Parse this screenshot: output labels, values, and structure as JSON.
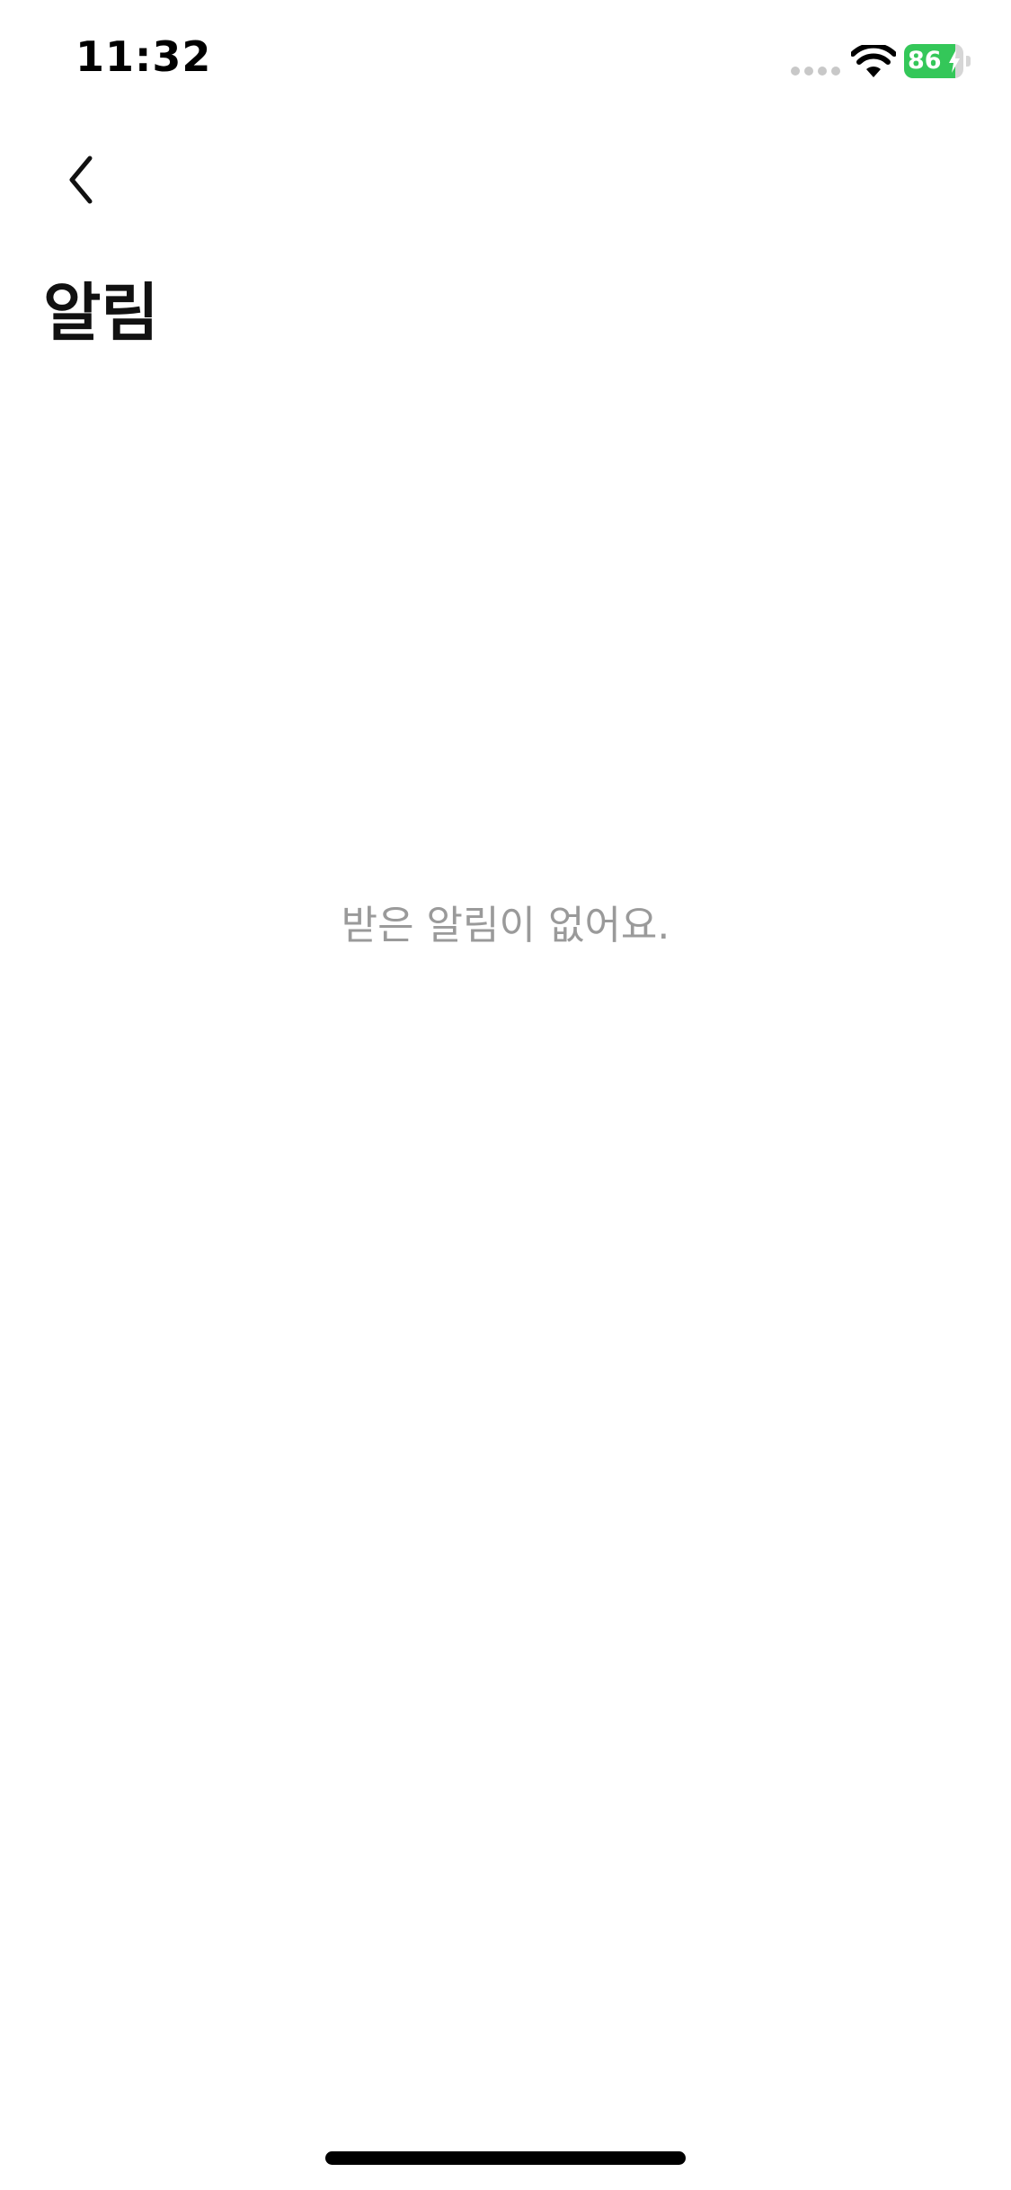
{
  "status_bar": {
    "time": "11:32",
    "battery_percent": "86",
    "battery_level": 0.86,
    "battery_charging": true,
    "icons": [
      "signal-dots-icon",
      "wifi-icon",
      "battery-icon",
      "lightning-icon"
    ]
  },
  "navigation": {
    "back_icon": "chevron-left-icon"
  },
  "header": {
    "title": "알림"
  },
  "empty_state": {
    "message": "받은 알림이 없어요."
  },
  "colors": {
    "background": "#ffffff",
    "title": "#111111",
    "empty_text": "#9a9a9a",
    "battery_green": "#34c759"
  }
}
